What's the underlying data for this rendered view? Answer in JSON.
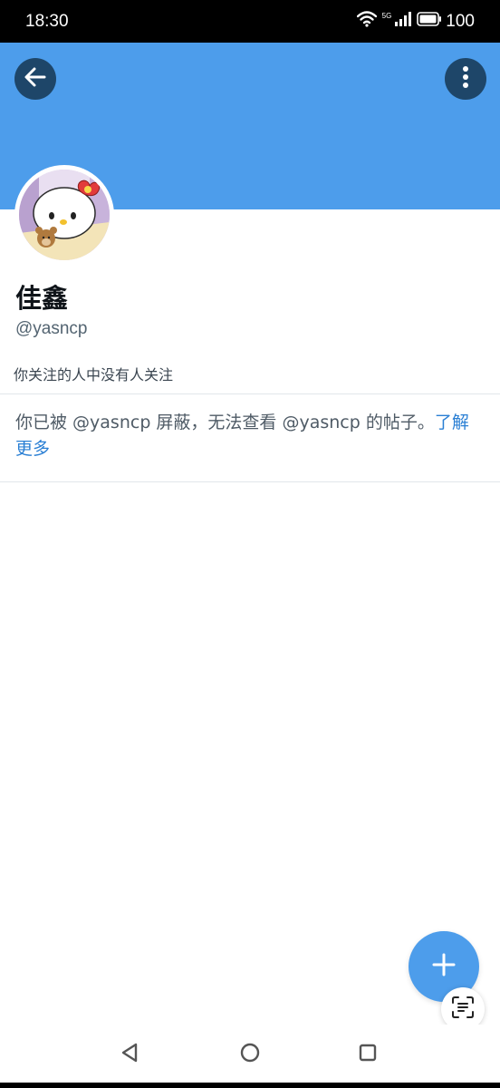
{
  "status_bar": {
    "time": "18:30",
    "network_label": "5G",
    "battery": "100",
    "icons": [
      "wifi-icon",
      "signal-icon",
      "battery-icon"
    ]
  },
  "header": {
    "banner_color": "#4d9deb",
    "button_color": "#1e4669",
    "back_icon": "arrow-left-icon",
    "more_icon": "vertical-ellipsis-icon"
  },
  "profile": {
    "display_name": "佳鑫",
    "handle": "@yasncp",
    "followers_note": "你关注的人中没有人关注",
    "blocked_message": "你已被 @yasncp 屏蔽，无法查看 @yasncp 的帖子。",
    "learn_more": "了解更多"
  },
  "actions": {
    "compose_icon": "plus-icon",
    "scan_icon": "text-scan-icon",
    "accent_color": "#4d9deb",
    "link_color": "#2a7fd4"
  },
  "nav": {
    "back_icon": "triangle-back-icon",
    "home_icon": "circle-home-icon",
    "recents_icon": "square-recents-icon"
  }
}
